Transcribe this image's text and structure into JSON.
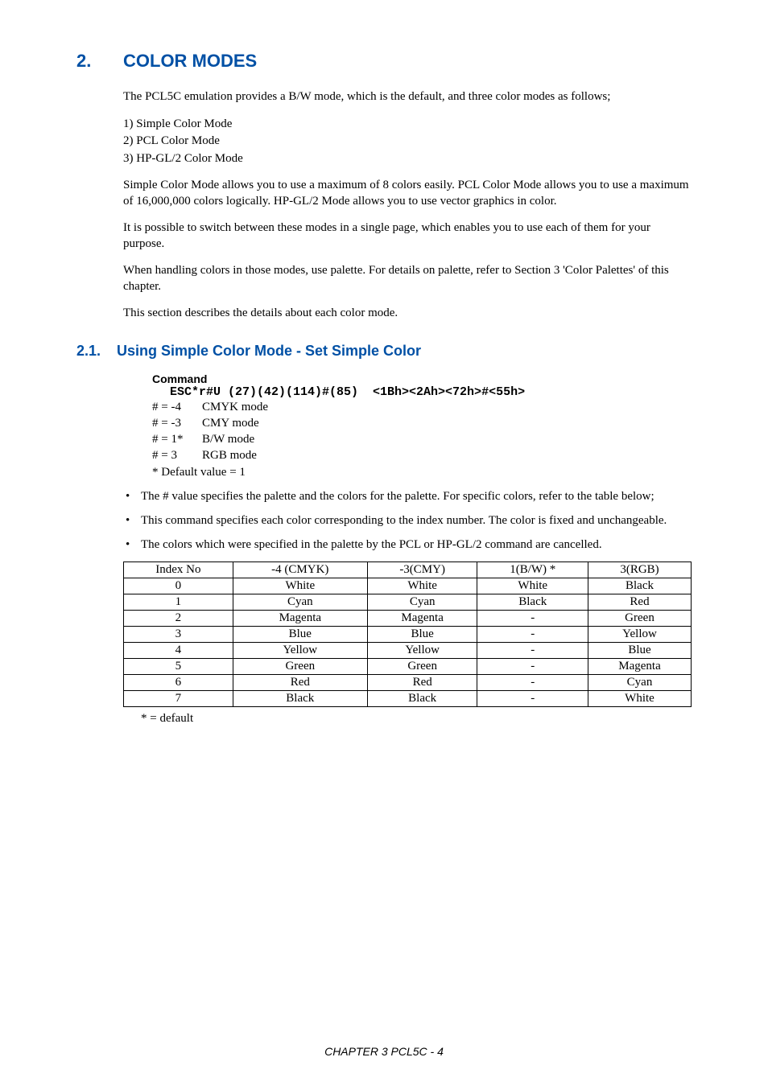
{
  "heading1": {
    "num": "2.",
    "title": "COLOR MODES"
  },
  "intro": "The PCL5C emulation provides a B/W mode, which is the default, and three color modes as follows;",
  "modes": [
    "1)  Simple Color Mode",
    "2)  PCL Color Mode",
    "3)  HP-GL/2 Color Mode"
  ],
  "para1": "Simple Color Mode allows you to use a maximum of 8 colors easily.    PCL Color Mode allows you to use a maximum of 16,000,000 colors logically.    HP-GL/2 Mode allows you to use vector graphics in color.",
  "para2": "It is possible to switch between these modes in a single page, which enables you to use each of them for your purpose.",
  "para3": "When handling colors in those modes, use palette.    For details on palette, refer to Section 3 'Color Palettes' of this chapter.",
  "para4": "This section describes the details about each color mode.",
  "heading2": {
    "num": "2.1.",
    "title": "Using Simple Color Mode - Set Simple Color"
  },
  "command": {
    "label": "Command",
    "code": "ESC*r#U (27)(42)(114)#(85)  <1Bh><2Ah><72h>#<55h>",
    "params": [
      {
        "k": "# = -4",
        "v": "CMYK mode"
      },
      {
        "k": "# = -3",
        "v": "CMY mode"
      },
      {
        "k": "# =  1*",
        "v": "B/W mode"
      },
      {
        "k": "# =  3",
        "v": "RGB mode"
      }
    ],
    "default": "* Default value = 1"
  },
  "bullets": [
    "The # value specifies the palette and the colors for the palette.    For specific colors, refer to the table below;",
    "This command specifies each color corresponding to the index number.    The color is fixed and unchangeable.",
    "The colors which were specified in the palette by the PCL or HP-GL/2 command are cancelled."
  ],
  "chart_data": {
    "type": "table",
    "headers": [
      "Index No",
      "-4 (CMYK)",
      "-3(CMY)",
      "1(B/W) *",
      "3(RGB)"
    ],
    "rows": [
      [
        "0",
        "White",
        "White",
        "White",
        "Black"
      ],
      [
        "1",
        "Cyan",
        "Cyan",
        "Black",
        "Red"
      ],
      [
        "2",
        "Magenta",
        "Magenta",
        "-",
        "Green"
      ],
      [
        "3",
        "Blue",
        "Blue",
        "-",
        "Yellow"
      ],
      [
        "4",
        "Yellow",
        "Yellow",
        "-",
        "Blue"
      ],
      [
        "5",
        "Green",
        "Green",
        "-",
        "Magenta"
      ],
      [
        "6",
        "Red",
        "Red",
        "-",
        "Cyan"
      ],
      [
        "7",
        "Black",
        "Black",
        "-",
        "White"
      ]
    ]
  },
  "table_footnote": "* = default",
  "footer": "CHAPTER 3 PCL5C - 4"
}
